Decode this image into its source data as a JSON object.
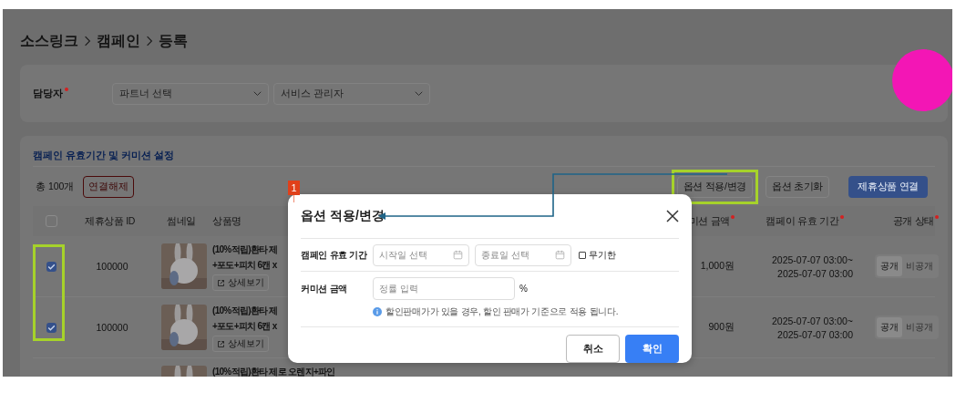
{
  "breadcrumb": [
    "소스링크",
    "캠페인",
    "등록"
  ],
  "manager": {
    "label": "담당자",
    "required": true,
    "selects": [
      {
        "placeholder": "파트너 선택"
      },
      {
        "placeholder": "서비스 관리자"
      }
    ]
  },
  "section": {
    "title": "캠페인 유효기간 및 커미션 설정",
    "total": "총 100개",
    "unlink_button": "연결해제",
    "buttons": [
      {
        "label": "옵션 적용/변경",
        "kind": "outline"
      },
      {
        "label": "옵션 초기화",
        "kind": "outline"
      },
      {
        "label": "제휴상품 연결",
        "kind": "primary"
      }
    ]
  },
  "table": {
    "columns": [
      {
        "kind": "checkbox",
        "checked": false
      },
      {
        "kind": "text",
        "label": "제휴상품 ID",
        "required": false
      },
      {
        "kind": "text",
        "label": "썸네일",
        "required": false
      },
      {
        "kind": "text",
        "label": "상품명",
        "required": false
      },
      {
        "kind": "text",
        "label": "미션 금액",
        "required": true
      },
      {
        "kind": "text",
        "label": "캠페이 유효 기간",
        "required": true
      },
      {
        "kind": "text",
        "label": "공개 상태",
        "required": true
      }
    ],
    "rows": [
      {
        "selected": true,
        "id": "100000",
        "thumbnail": {
          "kind": "picture"
        },
        "name": [
          "(10%적립)환타 제",
          "+포도+피치 6캔 x"
        ],
        "detail": "상세보기",
        "commission": "1,000원",
        "period": [
          "2025-07-07 03:00~",
          "2025-07-07 03:00"
        ],
        "status": [
          {
            "label": "공개",
            "selected": true
          },
          {
            "label": "비공개",
            "selected": false
          }
        ]
      },
      {
        "selected": true,
        "id": "100000",
        "thumbnail": {
          "kind": "picture"
        },
        "name": [
          "(10%적립)환타 제",
          "+포도+피치 6캔 x"
        ],
        "detail": "상세보기",
        "commission": "900원",
        "period": [
          "2025-07-07 03:00~",
          "2025-07-07 03:00"
        ],
        "status": [
          {
            "label": "공개",
            "selected": true
          },
          {
            "label": "비공개",
            "selected": false
          }
        ]
      },
      {
        "thumbnail": {
          "kind": "picture"
        },
        "name": [
          "(10%적립)환타 제로 오렌지+파인"
        ]
      }
    ]
  },
  "modal": {
    "title": "옵션 적용/변경",
    "period_label": "캠페인 유효 기간",
    "start_placeholder": "시작일 선택",
    "end_placeholder": "종료일 선택",
    "unlimited": {
      "label": "무기한",
      "checked": false
    },
    "commission_label": "커미션 금액",
    "rate_placeholder": "정률 입력",
    "unit": "%",
    "note": "할인판매가가 있을 경우, 할인 판매가 기준으로 적용 됩니다.",
    "buttons": [
      {
        "label": "취소",
        "kind": "secondary"
      },
      {
        "label": "확인",
        "kind": "primary"
      }
    ]
  },
  "annotation": {
    "badge": "1"
  }
}
